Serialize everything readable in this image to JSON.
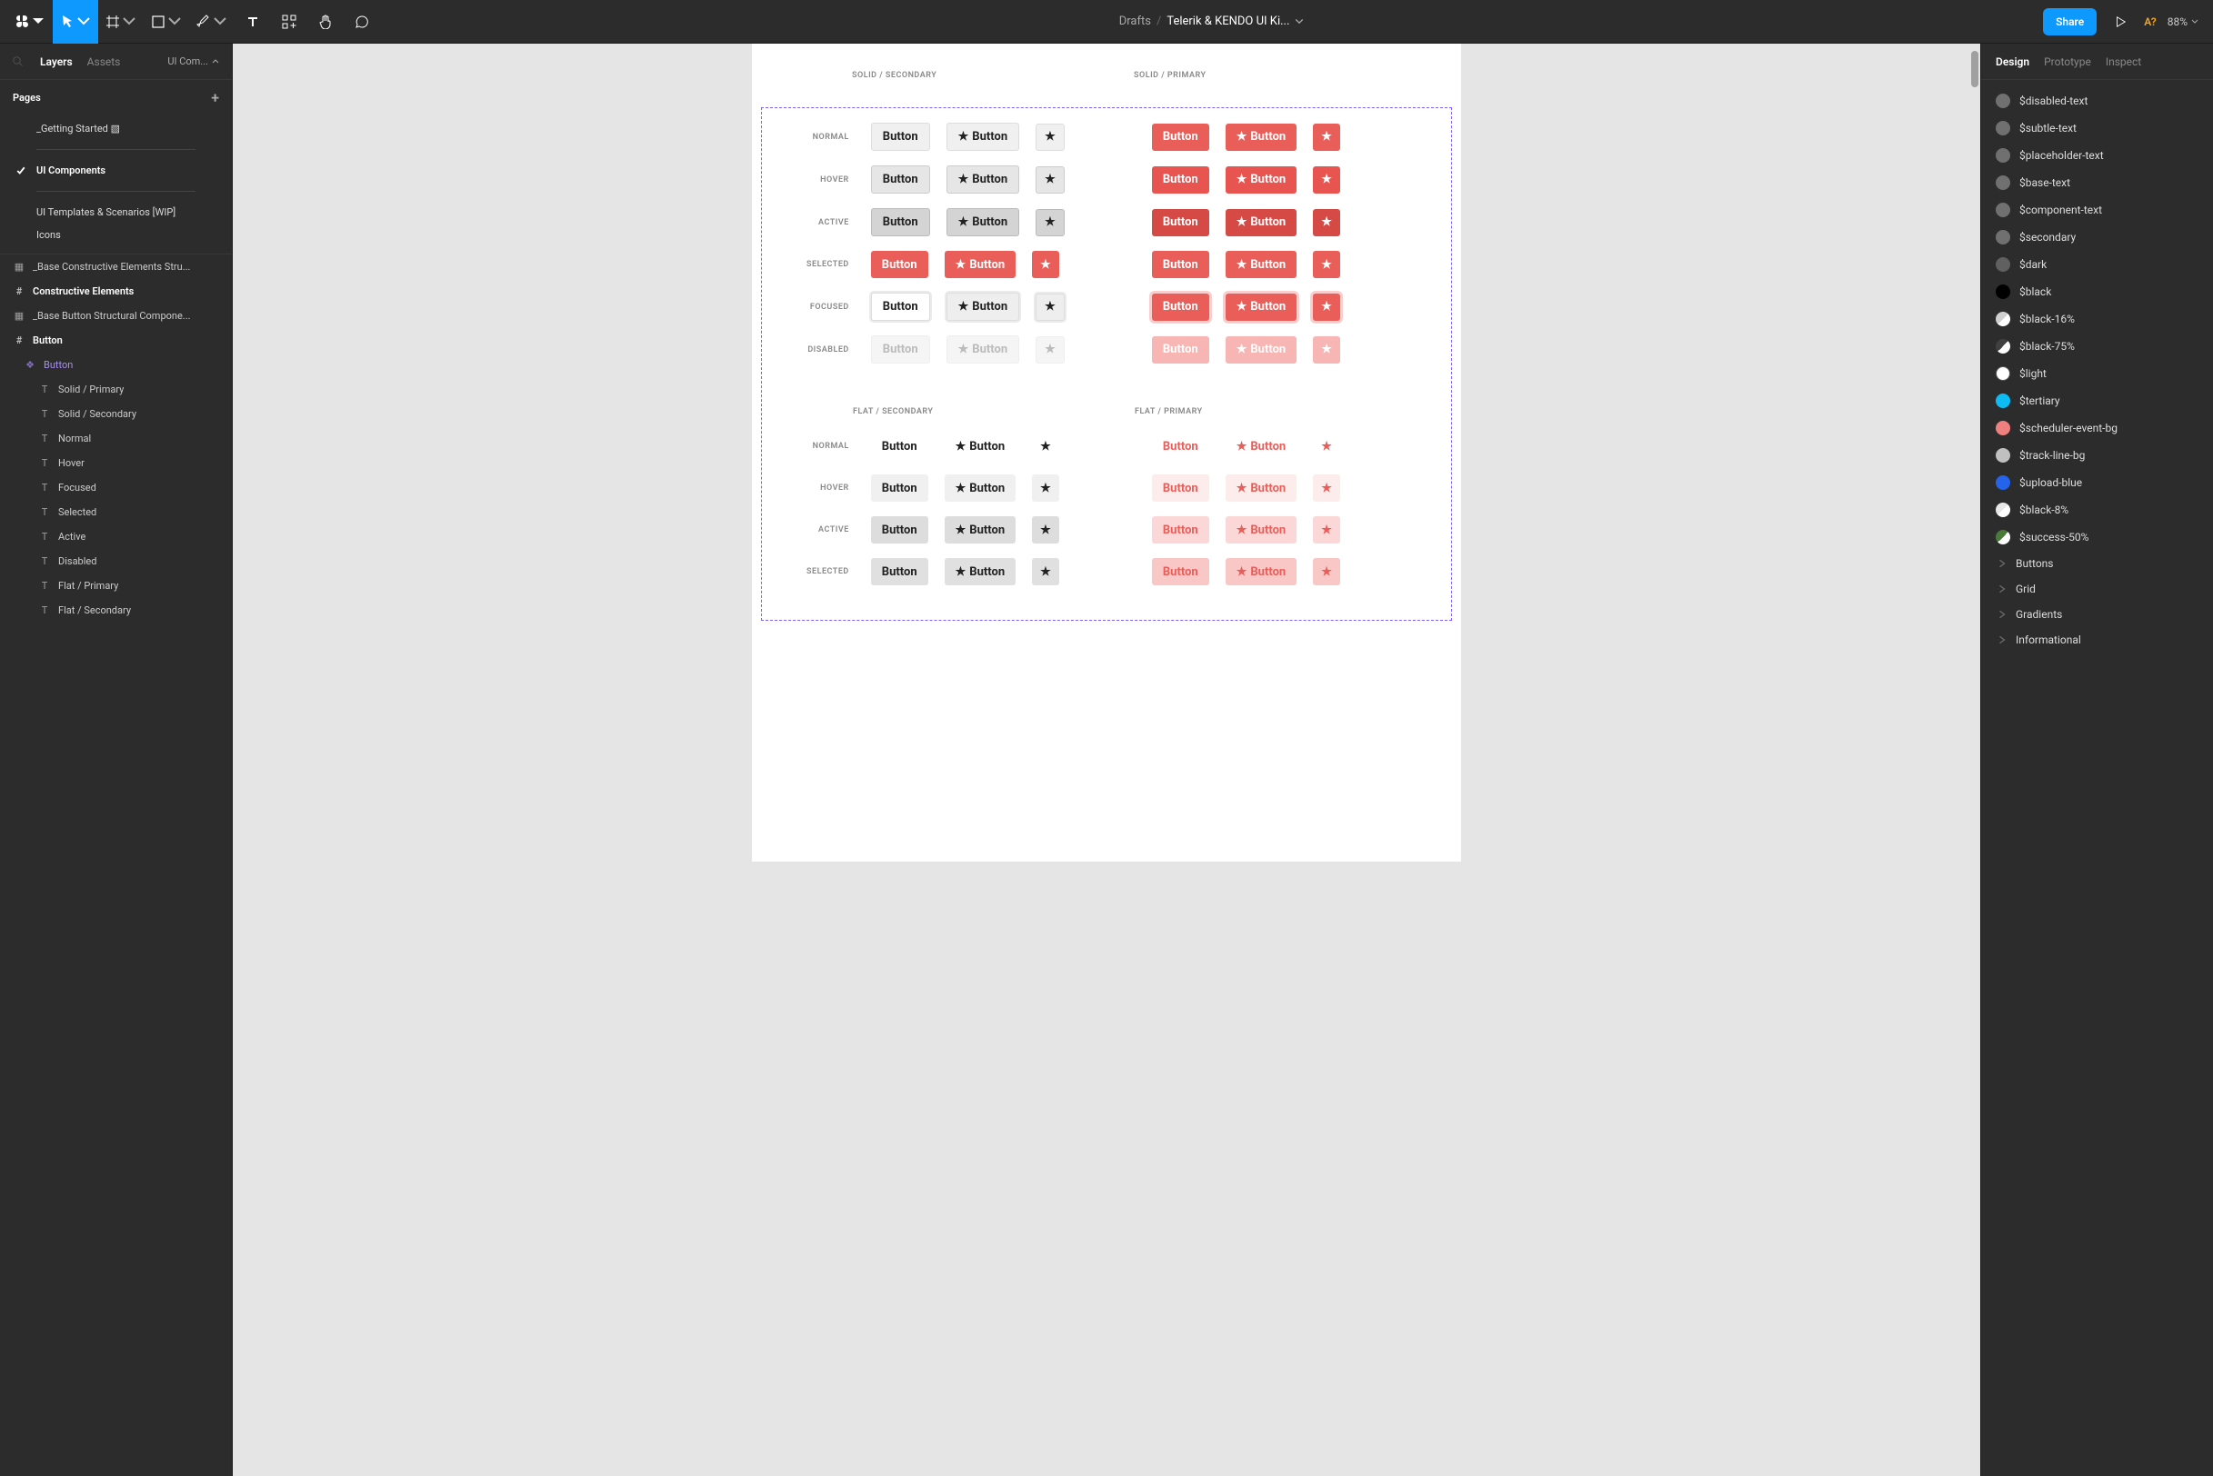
{
  "toolbar": {
    "breadcrumb_root": "Drafts",
    "filename": "Telerik & KENDO UI Ki...",
    "share": "Share",
    "user": "A?",
    "zoom": "88%"
  },
  "left": {
    "tab_layers": "Layers",
    "tab_assets": "Assets",
    "file_selector": "UI Com...",
    "pages_header": "Pages",
    "pages": {
      "getting_started": "_Getting Started ▧",
      "ui_components": "UI Components",
      "templates": "UI Templates & Scenarios [WIP]",
      "icons": "Icons"
    },
    "layers": {
      "base_constructive": "_Base Constructive Elements Stru...",
      "constructive": "Constructive Elements",
      "base_button": "_Base Button Structural Compone...",
      "button_frame": "Button",
      "button_component": "Button",
      "solid_primary": "Solid / Primary",
      "solid_secondary": "Solid / Secondary",
      "normal": "Normal",
      "hover": "Hover",
      "focused": "Focused",
      "selected": "Selected",
      "active": "Active",
      "disabled": "Disabled",
      "flat_primary": "Flat / Primary",
      "flat_secondary": "Flat / Secondary"
    }
  },
  "canvas": {
    "button_label": "Button",
    "solid_secondary": "SOLID / SECONDARY",
    "solid_primary": "SOLID / PRIMARY",
    "flat_secondary": "FLAT / SECONDARY",
    "flat_primary": "FLAT / PRIMARY",
    "rows": {
      "normal": "NORMAL",
      "hover": "HOVER",
      "active": "ACTIVE",
      "selected": "SELECTED",
      "focused": "FOCUSED",
      "disabled": "DISABLED"
    }
  },
  "right": {
    "tab_design": "Design",
    "tab_prototype": "Prototype",
    "tab_inspect": "Inspect",
    "styles": [
      {
        "name": "$disabled-text",
        "color": "#707070"
      },
      {
        "name": "$subtle-text",
        "color": "#707070"
      },
      {
        "name": "$placeholder-text",
        "color": "#707070"
      },
      {
        "name": "$base-text",
        "color": "#707070"
      },
      {
        "name": "$component-text",
        "color": "#707070"
      },
      {
        "name": "$secondary",
        "color": "#707070"
      },
      {
        "name": "$dark",
        "color": "#606060"
      },
      {
        "name": "$black",
        "color": "#000000"
      },
      {
        "name": "$black-16%",
        "color": "#d0d0d0",
        "half": true
      },
      {
        "name": "$black-75%",
        "color": "#404040",
        "half": true
      },
      {
        "name": "$light",
        "color": "#ffffff"
      },
      {
        "name": "$tertiary",
        "color": "#0dbcf2"
      },
      {
        "name": "$scheduler-event-bg",
        "color": "#f08080"
      },
      {
        "name": "$track-line-bg",
        "color": "#c0c0c0"
      },
      {
        "name": "$upload-blue",
        "color": "#2563eb"
      },
      {
        "name": "$black-8%",
        "color": "#e8e8e8",
        "half": true
      },
      {
        "name": "$success-50%",
        "color": "#4a7a3a",
        "half": true
      }
    ],
    "groups": [
      "Buttons",
      "Grid",
      "Gradients",
      "Informational"
    ]
  }
}
